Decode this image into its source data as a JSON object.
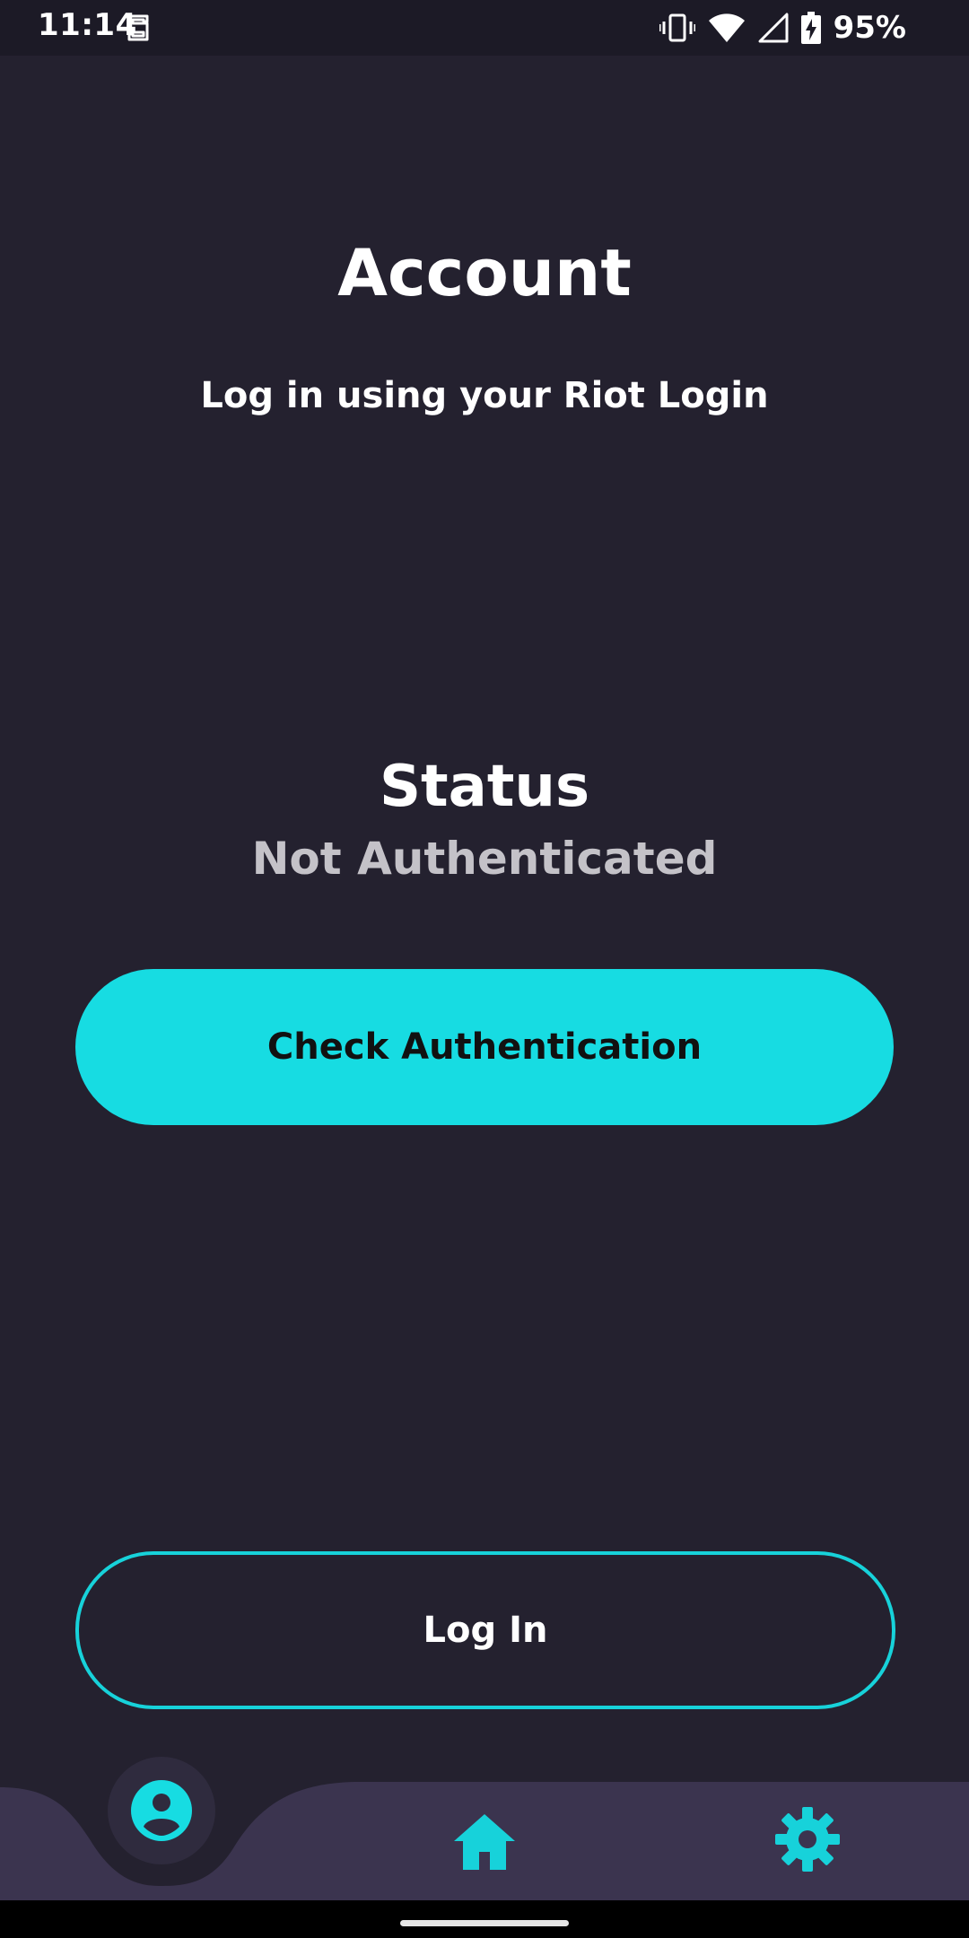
{
  "status_bar": {
    "time": "11:14",
    "battery_percent": "95%",
    "icons": [
      "app-notification-icon",
      "vibrate-icon",
      "wifi-icon",
      "cellular-signal-icon",
      "battery-charging-icon"
    ]
  },
  "header": {
    "title": "Account",
    "subtitle": "Log in using your Riot Login"
  },
  "auth_status": {
    "heading": "Status",
    "value": "Not Authenticated"
  },
  "buttons": {
    "check_authentication": "Check Authentication",
    "log_in": "Log In"
  },
  "bottom_nav": {
    "items": [
      {
        "icon": "account-icon",
        "selected": true
      },
      {
        "icon": "home-icon",
        "selected": false
      },
      {
        "icon": "settings-icon",
        "selected": false
      }
    ]
  },
  "colors": {
    "background": "#24212f",
    "accent": "#17dce2",
    "nav_background": "#3b344f",
    "muted_text": "#c4c2c8"
  }
}
